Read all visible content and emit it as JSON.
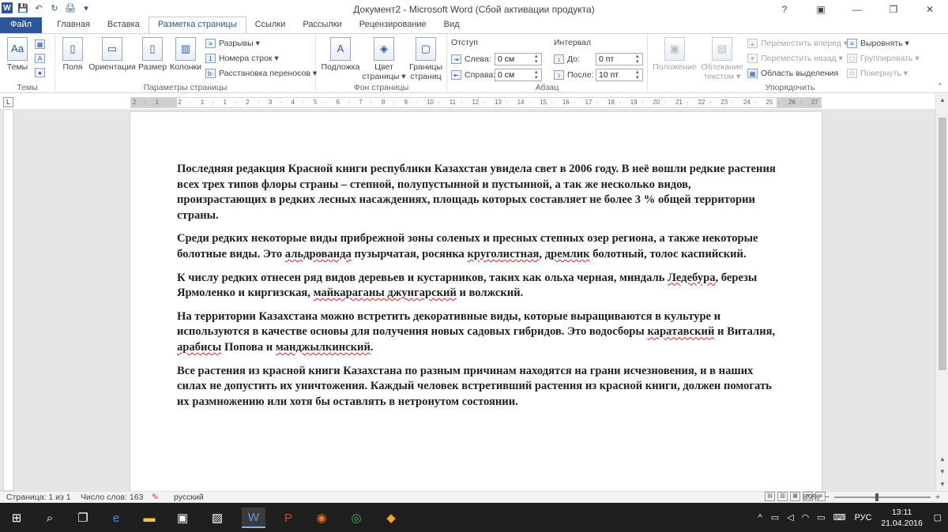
{
  "window": {
    "title": "Документ2 - Microsoft Word (Сбой активации продукта)",
    "min": "—",
    "max": "❐",
    "close": "✕",
    "help": "?"
  },
  "qat": {
    "app_icon": "W",
    "save": "💾",
    "undo": "↶",
    "redo": "↻",
    "print": "🖨",
    "more": "▾"
  },
  "tabs": [
    {
      "label": "Файл"
    },
    {
      "label": "Главная"
    },
    {
      "label": "Вставка"
    },
    {
      "label": "Разметка страницы"
    },
    {
      "label": "Ссылки"
    },
    {
      "label": "Рассылки"
    },
    {
      "label": "Рецензирование"
    },
    {
      "label": "Вид"
    }
  ],
  "ribbon": {
    "themes": {
      "label": "Темы",
      "btn": "Темы",
      "sub1": "A",
      "sub2": "■",
      "sub3": "●"
    },
    "page_setup": {
      "label": "Параметры страницы",
      "fields": "Поля",
      "orientation": "Ориентация",
      "size": "Размер",
      "columns": "Колонки",
      "breaks": "Разрывы ▾",
      "line_numbers": "Номера строк ▾",
      "hyphenation": "Расстановка переносов ▾"
    },
    "background": {
      "label": "Фон страницы",
      "watermark": "Подложка",
      "page_color_1": "Цвет",
      "page_color_2": "страницы ▾",
      "borders_1": "Границы",
      "borders_2": "страниц"
    },
    "paragraph": {
      "label": "Абзац",
      "indent": "Отступ",
      "left_label": "Слева:",
      "left_value": "0 см",
      "right_label": "Справа:",
      "right_value": "0 см",
      "spacing": "Интервал",
      "before_label": "До:",
      "before_value": "0 пт",
      "after_label": "После:",
      "after_value": "10 пт"
    },
    "arrange": {
      "label": "Упорядочить",
      "position": "Положение",
      "wrap_1": "Обтекание",
      "wrap_2": "текстом ▾",
      "forward": "Переместить вперед ▾",
      "backward": "Переместить назад ▾",
      "selection_pane": "Область выделения",
      "align": "Выровнять ▾",
      "group": "Группировать ▾",
      "rotate": "Повернуть ▾"
    }
  },
  "ruler": {
    "ticks": [
      "2",
      "·",
      "1",
      "·",
      "2",
      "·",
      "1",
      "·",
      "1",
      "·",
      "2",
      "·",
      "3",
      "·",
      "4",
      "·",
      "5",
      "·",
      "6",
      "·",
      "7",
      "·",
      "8",
      "·",
      "9",
      "·",
      "10",
      "·",
      "11",
      "·",
      "12",
      "·",
      "13",
      "·",
      "14",
      "·",
      "15",
      "·",
      "16",
      "·",
      "17",
      "·",
      "18",
      "·",
      "19",
      "·",
      "20",
      "·",
      "21",
      "·",
      "22",
      "·",
      "23",
      "·",
      "24",
      "·",
      "25",
      "·",
      "26",
      "·",
      "27"
    ],
    "corner": "L"
  },
  "document": {
    "p1": "Последняя редакция Красной книги республики Казахстан увидела свет в 2006 году. В неё вошли редкие растения всех трех типов флоры страны – степной, полупустынной и пустынной, а так же несколько видов, произрастающих в редких лесных насаждениях, площадь которых составляет не более 3 % общей территории страны.",
    "p2_a": "Среди редких некоторые виды прибрежной зоны соленых и пресных степных озер региона, а также некоторые болотные виды. Это ",
    "p2_s1": "альдрованда",
    "p2_b": " пузырчатая, росянка ",
    "p2_s2": "круголистная",
    "p2_c": ", ",
    "p2_s3": "дремлик",
    "p2_d": " болотный, толос каспийский.",
    "p3_a": "К числу редких отнесен ряд видов деревьев и кустарников, таких как ольха черная, миндаль ",
    "p3_s1": "Ледебура",
    "p3_b": ", березы Ярмоленко и киргизская, ",
    "p3_s2": "майкараганы джунгарский",
    "p3_c": " и волжский.",
    "p4_a": "На территории Казахстана можно встретить декоративные виды, которые выращиваются в культуре и используются в качестве основы для получения новых садовых гибридов. Это водосборы ",
    "p4_s1": "каратавский",
    "p4_b": " и Виталия, ",
    "p4_s2": "арабисы",
    "p4_c": " Попова и ",
    "p4_s3": "манджылкинский",
    "p4_d": ".",
    "p5": "Все растения из красной книги Казахстана по разным причинам находятся на грани исчезновения, и в наших силах не допустить их уничтожения. Каждый человек встретивший растения из красной книги, должен помогать их размножению или хотя бы оставлять в нетронутом состоянии."
  },
  "statusbar": {
    "page": "Страница: 1 из 1",
    "words": "Число слов: 163",
    "lang": "русский",
    "zoom": "89%",
    "minus": "−",
    "plus": "+"
  },
  "taskbar": {
    "lang": "РУС",
    "time": "13:11",
    "date": "21.04.2016"
  }
}
